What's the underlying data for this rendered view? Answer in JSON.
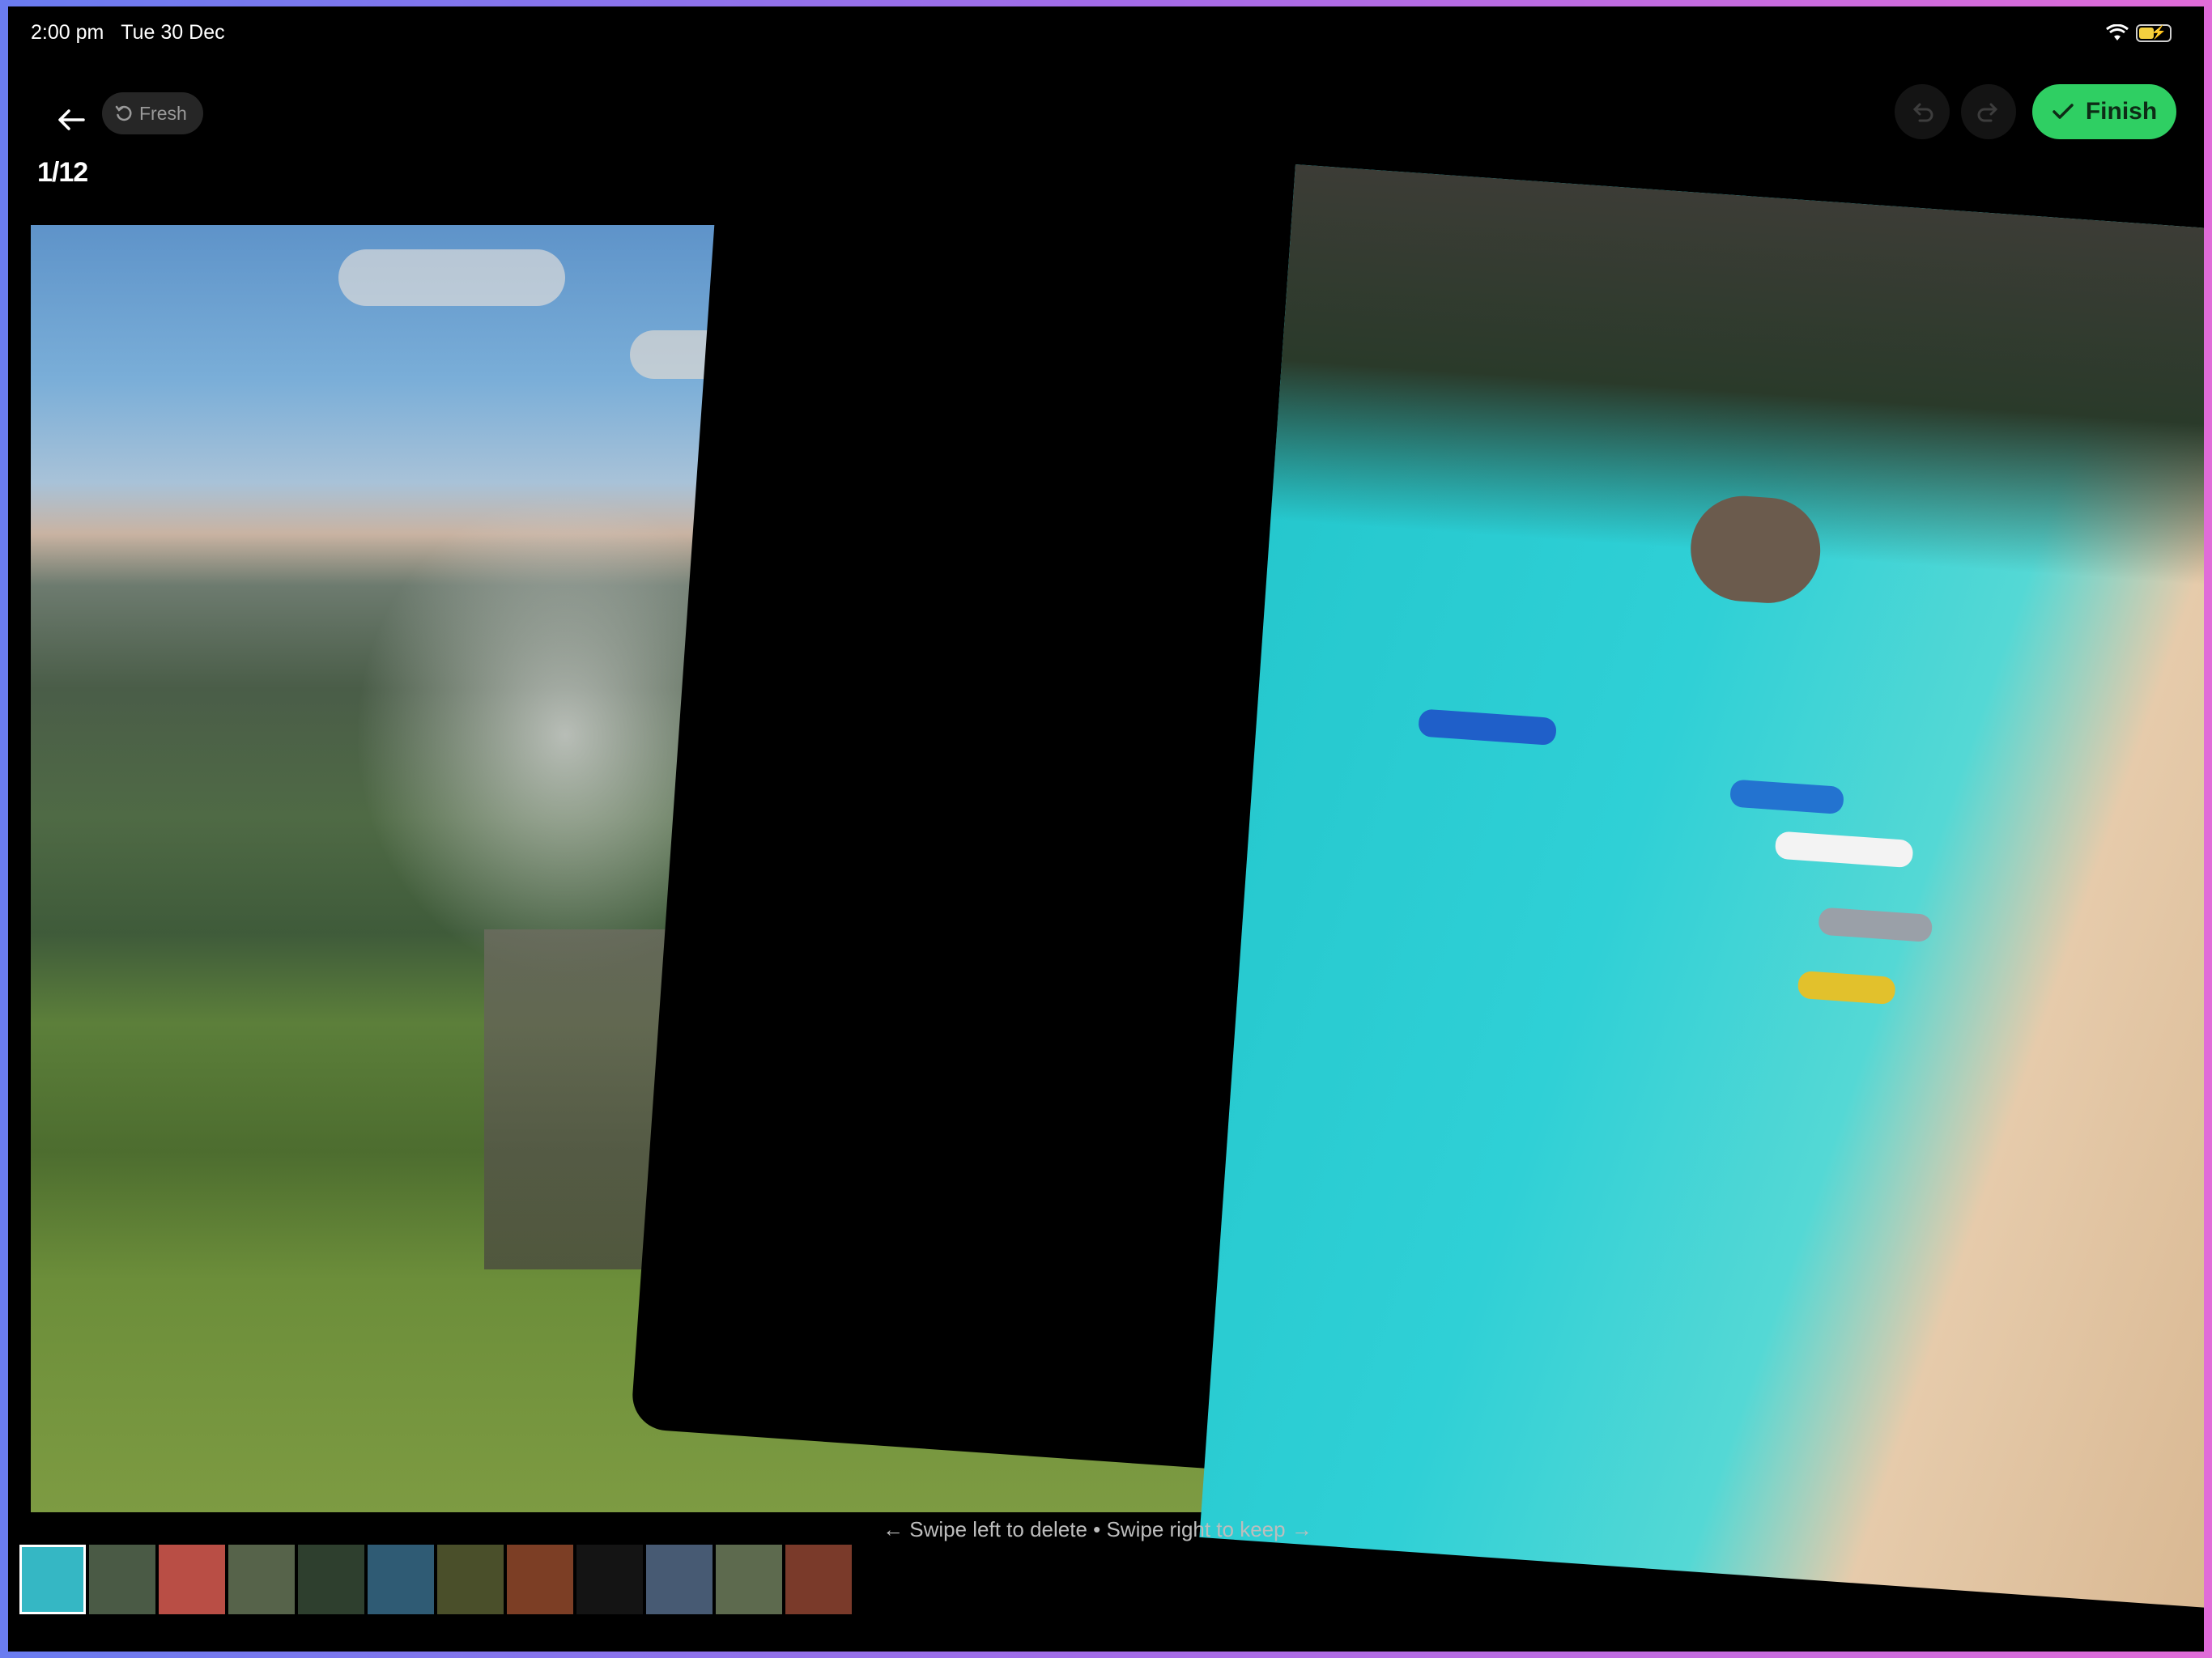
{
  "status_bar": {
    "time": "2:00 pm",
    "date": "Tue 30 Dec"
  },
  "header": {
    "fresh_label": "Fresh",
    "counter": "1/12",
    "finish_label": "Finish"
  },
  "colors": {
    "accent": "#2fcf63",
    "background": "#000000"
  },
  "hint": "← Swipe left to delete • Swipe right to keep →",
  "thumbnails": [
    {
      "name": "beach-aerial",
      "color": "#35b7c4"
    },
    {
      "name": "hills",
      "color": "#4a5a45"
    },
    {
      "name": "sunset-figure",
      "color": "#b94e45"
    },
    {
      "name": "valley",
      "color": "#56634a"
    },
    {
      "name": "forest-waterfall",
      "color": "#2e3f2e"
    },
    {
      "name": "ocean-wave",
      "color": "#2f5b74"
    },
    {
      "name": "forest-path",
      "color": "#4a4f2a"
    },
    {
      "name": "autumn-forest",
      "color": "#7c3e25"
    },
    {
      "name": "dark",
      "color": "#141414"
    },
    {
      "name": "coast-dusk",
      "color": "#475a73"
    },
    {
      "name": "cliff-sea",
      "color": "#5d6a4e"
    },
    {
      "name": "golden-gate",
      "color": "#7a3a2a"
    }
  ]
}
